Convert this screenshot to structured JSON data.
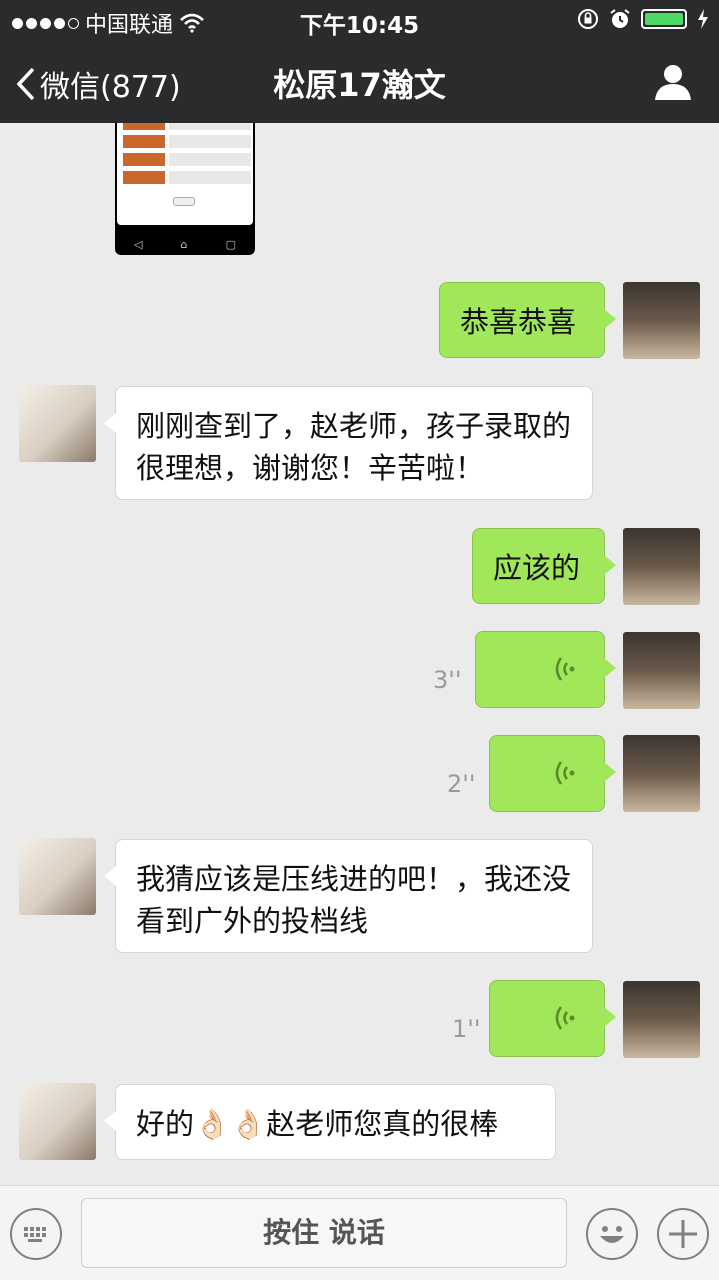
{
  "status_bar": {
    "carrier": "中国联通",
    "time": "下午10:45",
    "signal_icon": "signal-dots-icon",
    "wifi_icon": "wifi-icon",
    "battery_level": 1.0
  },
  "nav": {
    "back_label": "微信(877)",
    "title": "松原17瀚文",
    "profile_icon": "person-icon"
  },
  "messages": [
    {
      "from": "me",
      "type": "text",
      "text": "恭喜恭喜"
    },
    {
      "from": "them",
      "type": "text",
      "text": "刚刚查到了，赵老师，孩子录取的很理想，谢谢您！辛苦啦！"
    },
    {
      "from": "me",
      "type": "text",
      "text": "应该的"
    },
    {
      "from": "me",
      "type": "voice",
      "duration": "3''"
    },
    {
      "from": "me",
      "type": "voice",
      "duration": "2''"
    },
    {
      "from": "them",
      "type": "text",
      "text": "我猜应该是压线进的吧！，我还没看到广外的投档线"
    },
    {
      "from": "me",
      "type": "voice",
      "duration": "1''"
    },
    {
      "from": "them",
      "type": "text",
      "text": "好的👌🏻👌🏻赵老师您真的很棒"
    }
  ],
  "inputbar": {
    "hold_to_talk": "按住 说话",
    "keyboard_icon": "keyboard-icon",
    "emoji_icon": "emoji-icon",
    "plus_icon": "plus-icon"
  },
  "colors": {
    "bar": "#2b2b2d",
    "my_bubble": "#a0e75a",
    "their_bubble": "#ffffff",
    "chat_bg": "#ebebeb"
  }
}
